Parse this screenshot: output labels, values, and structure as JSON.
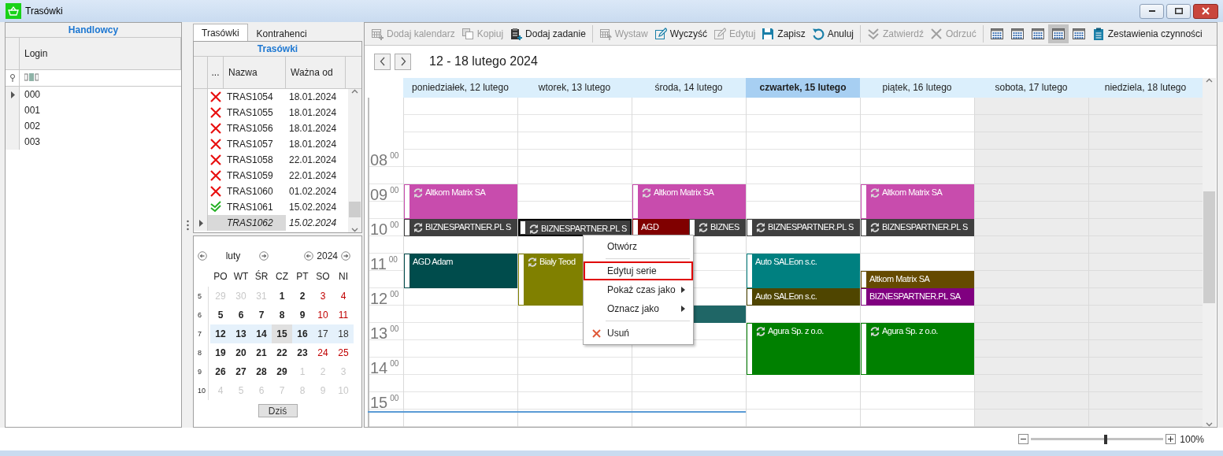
{
  "window": {
    "title": "Trasówki"
  },
  "salespeople": {
    "title": "Handlowcy",
    "column": "Login",
    "rows": [
      {
        "login": "000",
        "current": true
      },
      {
        "login": "001",
        "current": false
      },
      {
        "login": "002",
        "current": false
      },
      {
        "login": "003",
        "current": false
      }
    ]
  },
  "routes_panel": {
    "tabs": [
      {
        "label": "Trasówki",
        "selected": true
      },
      {
        "label": "Kontrahenci",
        "selected": false
      }
    ],
    "title": "Trasówki",
    "columns": [
      "...",
      "Nazwa",
      "Ważna od"
    ],
    "rows": [
      {
        "rejected": true,
        "approved": false,
        "name": "TRAS1054",
        "valid_from": "18.01.2024",
        "current": false
      },
      {
        "rejected": true,
        "approved": false,
        "name": "TRAS1055",
        "valid_from": "18.01.2024",
        "current": false
      },
      {
        "rejected": true,
        "approved": false,
        "name": "TRAS1056",
        "valid_from": "18.01.2024",
        "current": false
      },
      {
        "rejected": true,
        "approved": false,
        "name": "TRAS1057",
        "valid_from": "18.01.2024",
        "current": false
      },
      {
        "rejected": true,
        "approved": false,
        "name": "TRAS1058",
        "valid_from": "22.01.2024",
        "current": false
      },
      {
        "rejected": true,
        "approved": false,
        "name": "TRAS1059",
        "valid_from": "22.01.2024",
        "current": false
      },
      {
        "rejected": true,
        "approved": false,
        "name": "TRAS1060",
        "valid_from": "01.02.2024",
        "current": false
      },
      {
        "rejected": false,
        "approved": true,
        "name": "TRAS1061",
        "valid_from": "15.02.2024",
        "current": false
      },
      {
        "rejected": false,
        "approved": false,
        "name": "TRAS1062",
        "valid_from": "15.02.2024",
        "current": true
      }
    ]
  },
  "mini_calendar": {
    "month": "luty",
    "year": "2024",
    "weekdays": [
      "PO",
      "WT",
      "ŚR",
      "CZ",
      "PT",
      "SO",
      "NI"
    ],
    "weeks": [
      {
        "number": "5",
        "selected": false,
        "days": [
          {
            "day": "29",
            "other_month": true,
            "today": false
          },
          {
            "day": "30",
            "other_month": true,
            "today": false
          },
          {
            "day": "31",
            "other_month": true,
            "today": false
          },
          {
            "day": "1",
            "other_month": false,
            "today": false
          },
          {
            "day": "2",
            "other_month": false,
            "today": false
          },
          {
            "day": "3",
            "other_month": false,
            "today": false
          },
          {
            "day": "4",
            "other_month": false,
            "today": false
          }
        ]
      },
      {
        "number": "6",
        "selected": false,
        "days": [
          {
            "day": "5",
            "other_month": false,
            "today": false
          },
          {
            "day": "6",
            "other_month": false,
            "today": false
          },
          {
            "day": "7",
            "other_month": false,
            "today": false
          },
          {
            "day": "8",
            "other_month": false,
            "today": false
          },
          {
            "day": "9",
            "other_month": false,
            "today": false
          },
          {
            "day": "10",
            "other_month": false,
            "today": false
          },
          {
            "day": "11",
            "other_month": false,
            "today": false
          }
        ]
      },
      {
        "number": "7",
        "selected": true,
        "days": [
          {
            "day": "12",
            "other_month": false,
            "today": false
          },
          {
            "day": "13",
            "other_month": false,
            "today": false
          },
          {
            "day": "14",
            "other_month": false,
            "today": false
          },
          {
            "day": "15",
            "other_month": false,
            "today": true
          },
          {
            "day": "16",
            "other_month": false,
            "today": false
          },
          {
            "day": "17",
            "other_month": false,
            "today": false
          },
          {
            "day": "18",
            "other_month": false,
            "today": false
          }
        ]
      },
      {
        "number": "8",
        "selected": false,
        "days": [
          {
            "day": "19",
            "other_month": false,
            "today": false
          },
          {
            "day": "20",
            "other_month": false,
            "today": false
          },
          {
            "day": "21",
            "other_month": false,
            "today": false
          },
          {
            "day": "22",
            "other_month": false,
            "today": false
          },
          {
            "day": "23",
            "other_month": false,
            "today": false
          },
          {
            "day": "24",
            "other_month": false,
            "today": false
          },
          {
            "day": "25",
            "other_month": false,
            "today": false
          }
        ]
      },
      {
        "number": "9",
        "selected": false,
        "days": [
          {
            "day": "26",
            "other_month": false,
            "today": false
          },
          {
            "day": "27",
            "other_month": false,
            "today": false
          },
          {
            "day": "28",
            "other_month": false,
            "today": false
          },
          {
            "day": "29",
            "other_month": false,
            "today": false
          },
          {
            "day": "1",
            "other_month": true,
            "today": false
          },
          {
            "day": "2",
            "other_month": true,
            "today": false
          },
          {
            "day": "3",
            "other_month": true,
            "today": false
          }
        ]
      },
      {
        "number": "10",
        "selected": false,
        "days": [
          {
            "day": "4",
            "other_month": true,
            "today": false
          },
          {
            "day": "5",
            "other_month": true,
            "today": false
          },
          {
            "day": "6",
            "other_month": true,
            "today": false
          },
          {
            "day": "7",
            "other_month": true,
            "today": false
          },
          {
            "day": "8",
            "other_month": true,
            "today": false
          },
          {
            "day": "9",
            "other_month": true,
            "today": false
          },
          {
            "day": "10",
            "other_month": true,
            "today": false
          }
        ]
      }
    ],
    "today_button": "Dziś"
  },
  "toolbar": [
    {
      "kind": "button",
      "label": "Dodaj kalendarz",
      "disabled": true
    },
    {
      "kind": "button",
      "label": "Kopiuj",
      "disabled": true
    },
    {
      "kind": "button",
      "label": "Dodaj zadanie",
      "disabled": false
    },
    {
      "kind": "separator"
    },
    {
      "kind": "button",
      "label": "Wystaw",
      "disabled": true
    },
    {
      "kind": "button",
      "label": "Wyczyść",
      "disabled": false
    },
    {
      "kind": "button",
      "label": "Edytuj",
      "disabled": true
    },
    {
      "kind": "button",
      "label": "Zapisz",
      "disabled": false
    },
    {
      "kind": "button",
      "label": "Anuluj",
      "disabled": false
    },
    {
      "kind": "separator"
    },
    {
      "kind": "button",
      "label": "Zatwierdź",
      "disabled": true
    },
    {
      "kind": "button",
      "label": "Odrzuć",
      "disabled": true
    },
    {
      "kind": "separator"
    },
    {
      "kind": "view",
      "selected": false
    },
    {
      "kind": "view",
      "selected": false
    },
    {
      "kind": "view",
      "selected": false
    },
    {
      "kind": "view",
      "selected": true
    },
    {
      "kind": "view",
      "selected": false
    },
    {
      "kind": "button",
      "label": "Zestawienia czynności",
      "disabled": false
    }
  ],
  "calendar": {
    "range": "12 - 18 lutego 2024",
    "hours": [
      {
        "hour": "08",
        "minutes": "00"
      },
      {
        "hour": "09",
        "minutes": "00"
      },
      {
        "hour": "10",
        "minutes": "00"
      },
      {
        "hour": "11",
        "minutes": "00"
      },
      {
        "hour": "12",
        "minutes": "00"
      },
      {
        "hour": "13",
        "minutes": "00"
      },
      {
        "hour": "14",
        "minutes": "00"
      },
      {
        "hour": "15",
        "minutes": "00"
      }
    ],
    "days": [
      {
        "label": "poniedziałek, 12 lutego",
        "today": false,
        "weekend": false,
        "blocks": [
          {
            "kind": "gap"
          },
          {
            "kind": "gap"
          },
          {
            "kind": "gap"
          },
          {
            "kind": "gap"
          },
          {
            "kind": "gap"
          },
          {
            "kind": "hour",
            "title": "Altkom Matrix SA",
            "color": "#c84cad",
            "recurring": true,
            "selected": false
          },
          {
            "kind": "half-hour",
            "title": "BIZNESPARTNER.PL S",
            "color": "#3f3f3f",
            "recurring": true,
            "selected": false
          },
          {
            "kind": "gap"
          },
          {
            "kind": "hour",
            "title": "AGD Adam",
            "color": "#004c4c",
            "recurring": false,
            "selected": false
          }
        ]
      },
      {
        "label": "wtorek, 13 lutego",
        "today": false,
        "weekend": false,
        "blocks": [
          {
            "kind": "gap"
          },
          {
            "kind": "gap"
          },
          {
            "kind": "gap"
          },
          {
            "kind": "gap"
          },
          {
            "kind": "gap"
          },
          {
            "kind": "gap"
          },
          {
            "kind": "gap"
          },
          {
            "kind": "half-hour",
            "title": "BIZNESPARTNER.PL S",
            "color": "#3f3f3f",
            "recurring": true,
            "selected": true
          },
          {
            "kind": "gap"
          },
          {
            "kind": "hour-and-half",
            "title": "Biały Teod",
            "color": "#808000",
            "recurring": true,
            "selected": false
          }
        ]
      },
      {
        "label": "środa, 14 lutego",
        "today": false,
        "weekend": false,
        "blocks": [
          {
            "kind": "gap"
          },
          {
            "kind": "gap"
          },
          {
            "kind": "gap"
          },
          {
            "kind": "gap"
          },
          {
            "kind": "gap"
          },
          {
            "kind": "hour",
            "title": "Altkom Matrix SA",
            "color": "#c84cad",
            "recurring": true,
            "selected": false
          },
          {
            "kind": "split",
            "events": [
              {
                "title": "AGD",
                "color": "#800000",
                "recurring": false,
                "selected": false
              },
              {
                "title": "BIZNES",
                "color": "#3f3f3f",
                "recurring": true,
                "selected": false
              }
            ]
          },
          {
            "kind": "gap"
          },
          {
            "kind": "gap"
          },
          {
            "kind": "gap"
          },
          {
            "kind": "gap"
          },
          {
            "kind": "half-hour",
            "color": "#1f6666",
            "recurring": false,
            "selected": false
          }
        ]
      },
      {
        "label": "czwartek, 15 lutego",
        "today": true,
        "weekend": false,
        "blocks": [
          {
            "kind": "gap"
          },
          {
            "kind": "gap"
          },
          {
            "kind": "gap"
          },
          {
            "kind": "gap"
          },
          {
            "kind": "gap"
          },
          {
            "kind": "gap"
          },
          {
            "kind": "gap"
          },
          {
            "kind": "half-hour",
            "title": "BIZNESPARTNER.PL S",
            "color": "#3f3f3f",
            "recurring": true,
            "selected": false
          },
          {
            "kind": "gap"
          },
          {
            "kind": "hour",
            "title": "Auto SALEon s.c.",
            "color": "#008080",
            "recurring": false,
            "selected": false
          },
          {
            "kind": "half-hour",
            "title": "Auto SALEon s.c.",
            "color": "#4f4500",
            "recurring": false,
            "selected": false
          },
          {
            "kind": "gap"
          },
          {
            "kind": "hour-and-half",
            "title": "Agura Sp. z o.o.",
            "color": "#008000",
            "recurring": true,
            "selected": false
          }
        ]
      },
      {
        "label": "piątek, 16 lutego",
        "today": false,
        "weekend": false,
        "blocks": [
          {
            "kind": "gap"
          },
          {
            "kind": "gap"
          },
          {
            "kind": "gap"
          },
          {
            "kind": "gap"
          },
          {
            "kind": "gap"
          },
          {
            "kind": "hour",
            "title": "Altkom Matrix SA",
            "color": "#c84cad",
            "recurring": true,
            "selected": false
          },
          {
            "kind": "half-hour",
            "title": "BIZNESPARTNER.PL S",
            "color": "#3f3f3f",
            "recurring": true,
            "selected": false
          },
          {
            "kind": "gap"
          },
          {
            "kind": "gap"
          },
          {
            "kind": "half-hour",
            "title": "Altkom Matrix SA",
            "color": "#654a00",
            "recurring": false,
            "selected": false
          },
          {
            "kind": "half-hour",
            "title": "BIZNESPARTNER.PL SA",
            "color": "#800080",
            "recurring": false,
            "selected": false
          },
          {
            "kind": "gap"
          },
          {
            "kind": "hour-and-half",
            "title": "Agura Sp. z o.o.",
            "color": "#008000",
            "recurring": true,
            "selected": false
          }
        ]
      },
      {
        "label": "sobota, 17 lutego",
        "today": false,
        "weekend": true
      },
      {
        "label": "niedziela, 18 lutego",
        "today": false,
        "weekend": true
      }
    ]
  },
  "context_menu": {
    "items": [
      {
        "kind": "item",
        "label": "Otwórz",
        "selected": false,
        "submenu": false
      },
      {
        "kind": "separator"
      },
      {
        "kind": "item",
        "label": "Edytuj serie",
        "selected": true,
        "submenu": false
      },
      {
        "kind": "item",
        "label": "Pokaż czas jako",
        "selected": false,
        "submenu": true
      },
      {
        "kind": "item",
        "label": "Oznacz jako",
        "selected": false,
        "submenu": true
      },
      {
        "kind": "separator"
      },
      {
        "kind": "delete-item",
        "label": "Usuń",
        "selected": false,
        "submenu": false
      }
    ]
  },
  "status_bar": {
    "zoom": {
      "level": 0.56,
      "reading": "100%"
    }
  }
}
